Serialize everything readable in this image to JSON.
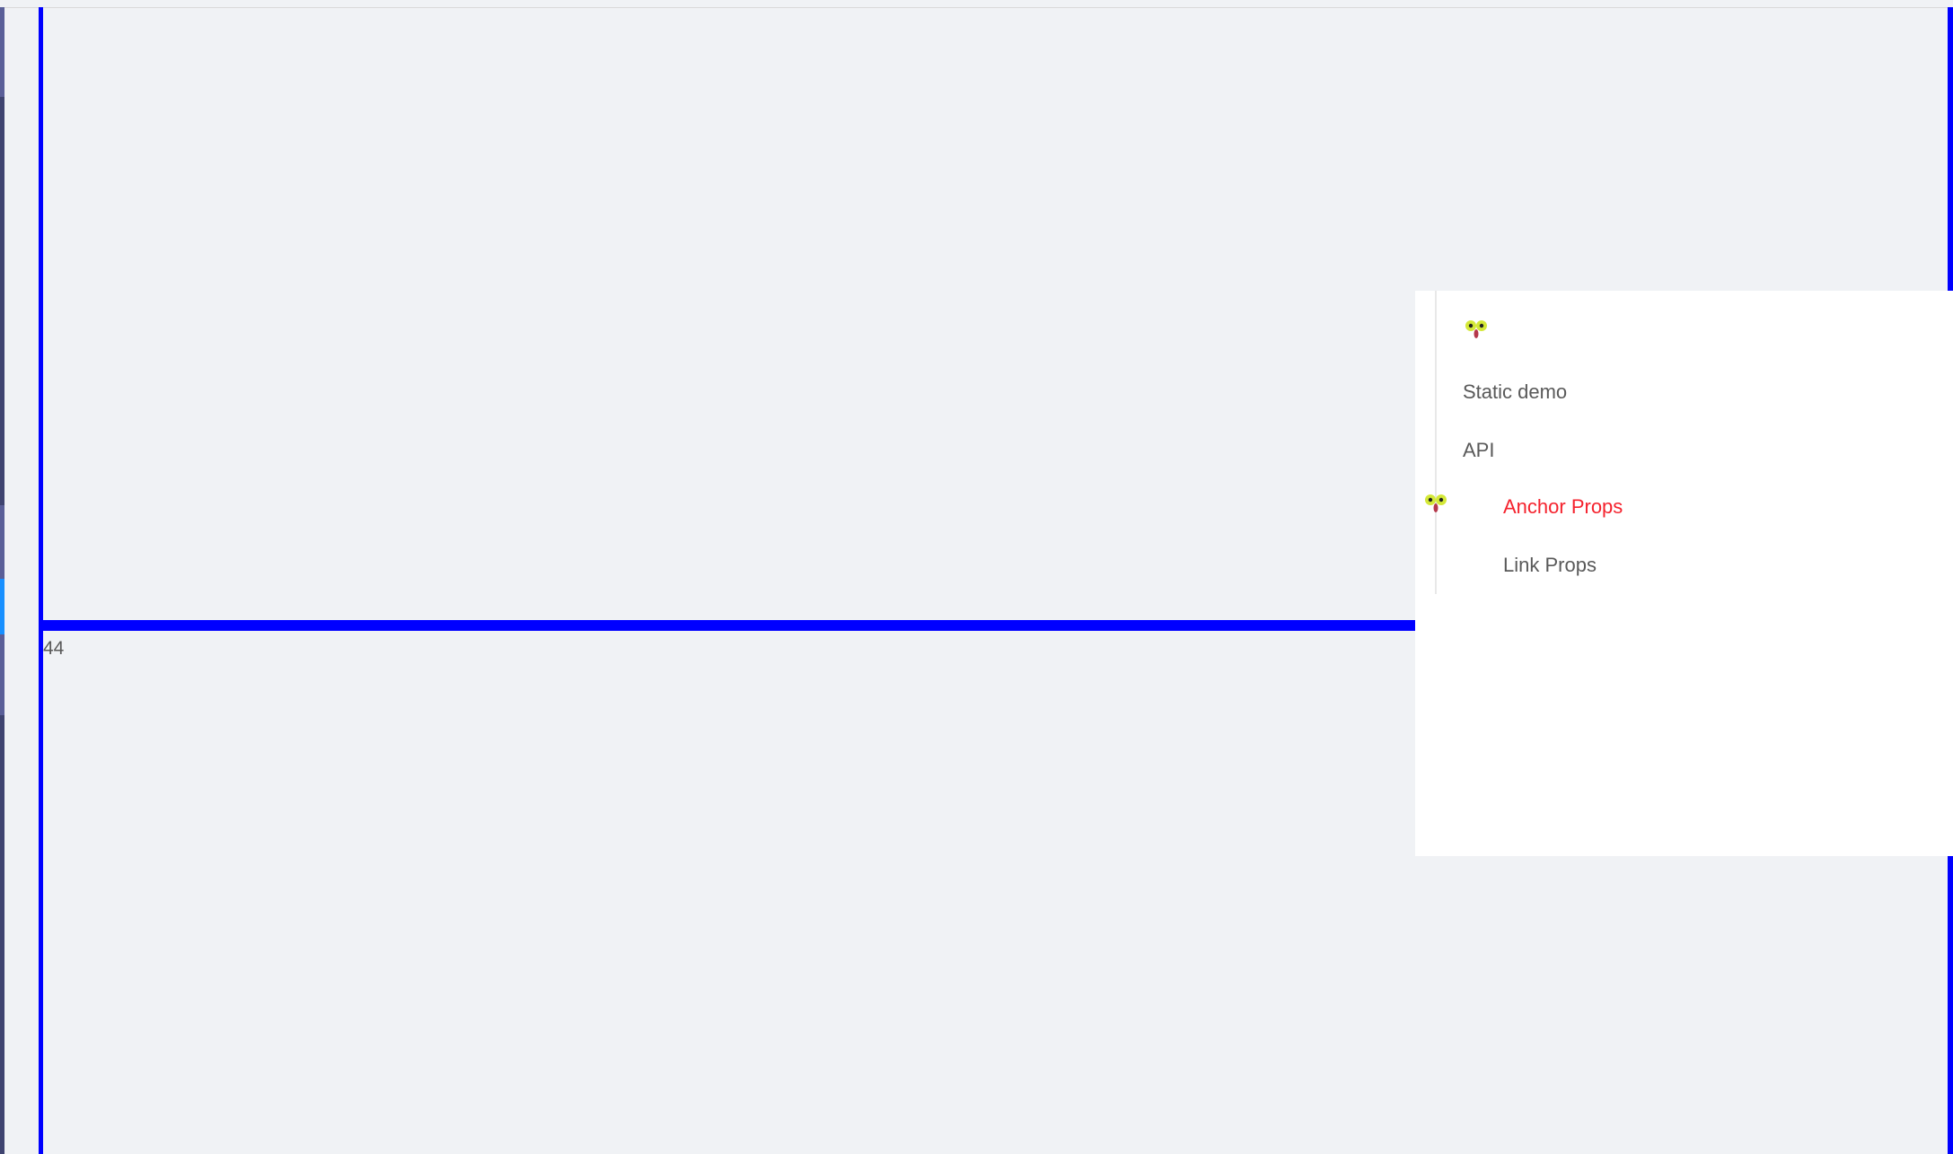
{
  "offset_readout": "44",
  "anchor": {
    "links": [
      {
        "label": "Static demo",
        "active": false
      },
      {
        "label": "API",
        "active": false
      },
      {
        "label": "Anchor Props",
        "active": true
      },
      {
        "label": "Link Props",
        "active": false
      }
    ]
  },
  "icons": {
    "ink": "cartoon-face-icon"
  },
  "colors": {
    "page_background": "#f0f2f5",
    "panel_background": "#ffffff",
    "active_link": "#f5222d",
    "link_text": "#595959",
    "guide_lines": "#0000ff",
    "sidebar": "#3f4470",
    "sidebar_selected": "#1890ff"
  }
}
